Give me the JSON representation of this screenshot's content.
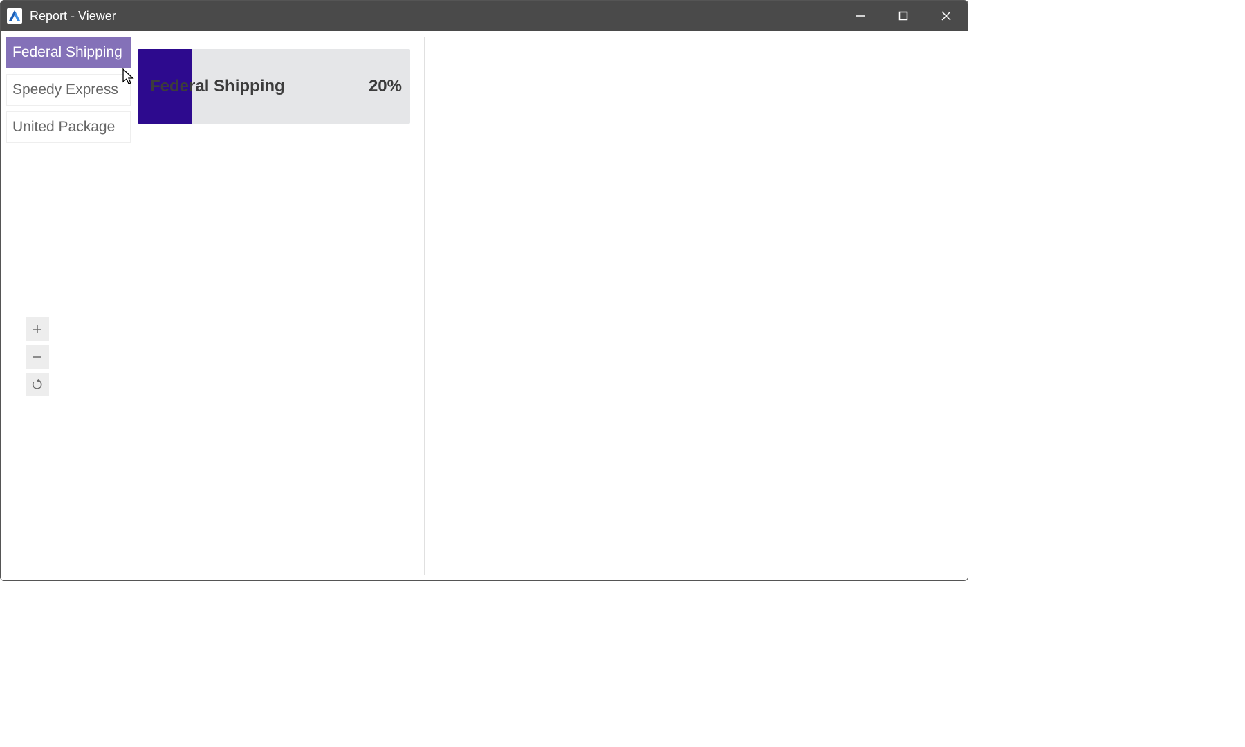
{
  "window": {
    "title": "Report - Viewer"
  },
  "sidebar": {
    "items": [
      {
        "label": "Federal Shipping",
        "selected": true
      },
      {
        "label": "Speedy Express",
        "selected": false
      },
      {
        "label": "United Package",
        "selected": false
      }
    ]
  },
  "progress": {
    "label": "Federal Shipping",
    "value_text": "20%",
    "percent": 20
  },
  "colors": {
    "titlebar_bg": "#4a4a4a",
    "selected_bg": "#8471b8",
    "progress_fill": "#2d0a8e",
    "progress_track": "#e5e6e8"
  },
  "chart_data": {
    "type": "bar",
    "categories": [
      "Federal Shipping"
    ],
    "values": [
      20
    ],
    "title": "",
    "xlabel": "",
    "ylabel": "",
    "ylim": [
      0,
      100
    ]
  }
}
